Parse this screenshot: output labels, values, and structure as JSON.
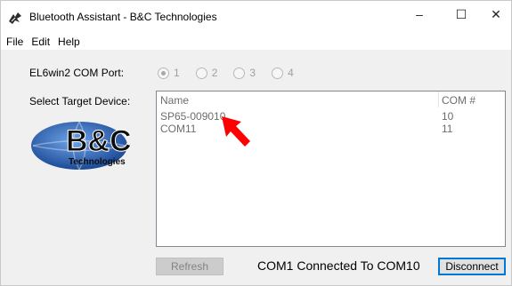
{
  "window": {
    "title": "Bluetooth Assistant - B&C Technologies",
    "minimize_glyph": "–",
    "maximize_glyph": "☐",
    "close_glyph": "✕"
  },
  "menu": [
    "File",
    "Edit",
    "Help"
  ],
  "com_port": {
    "label": "EL6win2 COM Port:",
    "options": [
      "1",
      "2",
      "3",
      "4"
    ],
    "selected": "1"
  },
  "target": {
    "label": "Select Target Device:"
  },
  "device_list": {
    "columns": [
      "Name",
      "COM #"
    ],
    "rows": [
      {
        "name": "SP65-009010",
        "com": "10"
      },
      {
        "name": "COM11",
        "com": "11"
      }
    ]
  },
  "logo": {
    "text": "B&C",
    "subtext": "Technologies"
  },
  "buttons": {
    "refresh": "Refresh",
    "disconnect": "Disconnect"
  },
  "status": "COM1 Connected To COM10",
  "colors": {
    "annotation_arrow": "#ff0000",
    "logo_blue": "#1f4fa3"
  }
}
